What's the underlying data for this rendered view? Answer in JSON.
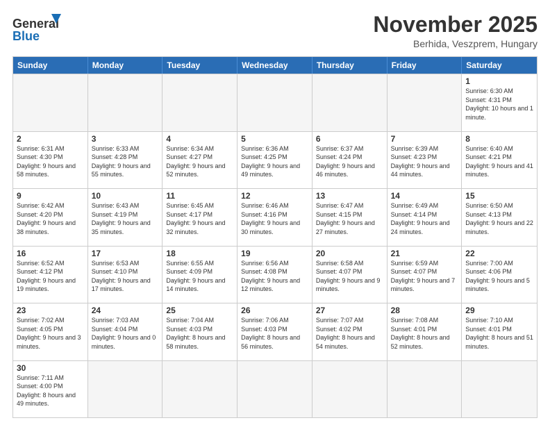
{
  "logo": {
    "text_general": "General",
    "text_blue": "Blue"
  },
  "title": "November 2025",
  "subtitle": "Berhida, Veszprem, Hungary",
  "header_days": [
    "Sunday",
    "Monday",
    "Tuesday",
    "Wednesday",
    "Thursday",
    "Friday",
    "Saturday"
  ],
  "weeks": [
    [
      {
        "day": "",
        "info": "",
        "empty": true
      },
      {
        "day": "",
        "info": "",
        "empty": true
      },
      {
        "day": "",
        "info": "",
        "empty": true
      },
      {
        "day": "",
        "info": "",
        "empty": true
      },
      {
        "day": "",
        "info": "",
        "empty": true
      },
      {
        "day": "",
        "info": "",
        "empty": true
      },
      {
        "day": "1",
        "info": "Sunrise: 6:30 AM\nSunset: 4:31 PM\nDaylight: 10 hours\nand 1 minute.",
        "empty": false
      }
    ],
    [
      {
        "day": "2",
        "info": "Sunrise: 6:31 AM\nSunset: 4:30 PM\nDaylight: 9 hours\nand 58 minutes.",
        "empty": false
      },
      {
        "day": "3",
        "info": "Sunrise: 6:33 AM\nSunset: 4:28 PM\nDaylight: 9 hours\nand 55 minutes.",
        "empty": false
      },
      {
        "day": "4",
        "info": "Sunrise: 6:34 AM\nSunset: 4:27 PM\nDaylight: 9 hours\nand 52 minutes.",
        "empty": false
      },
      {
        "day": "5",
        "info": "Sunrise: 6:36 AM\nSunset: 4:25 PM\nDaylight: 9 hours\nand 49 minutes.",
        "empty": false
      },
      {
        "day": "6",
        "info": "Sunrise: 6:37 AM\nSunset: 4:24 PM\nDaylight: 9 hours\nand 46 minutes.",
        "empty": false
      },
      {
        "day": "7",
        "info": "Sunrise: 6:39 AM\nSunset: 4:23 PM\nDaylight: 9 hours\nand 44 minutes.",
        "empty": false
      },
      {
        "day": "8",
        "info": "Sunrise: 6:40 AM\nSunset: 4:21 PM\nDaylight: 9 hours\nand 41 minutes.",
        "empty": false
      }
    ],
    [
      {
        "day": "9",
        "info": "Sunrise: 6:42 AM\nSunset: 4:20 PM\nDaylight: 9 hours\nand 38 minutes.",
        "empty": false
      },
      {
        "day": "10",
        "info": "Sunrise: 6:43 AM\nSunset: 4:19 PM\nDaylight: 9 hours\nand 35 minutes.",
        "empty": false
      },
      {
        "day": "11",
        "info": "Sunrise: 6:45 AM\nSunset: 4:17 PM\nDaylight: 9 hours\nand 32 minutes.",
        "empty": false
      },
      {
        "day": "12",
        "info": "Sunrise: 6:46 AM\nSunset: 4:16 PM\nDaylight: 9 hours\nand 30 minutes.",
        "empty": false
      },
      {
        "day": "13",
        "info": "Sunrise: 6:47 AM\nSunset: 4:15 PM\nDaylight: 9 hours\nand 27 minutes.",
        "empty": false
      },
      {
        "day": "14",
        "info": "Sunrise: 6:49 AM\nSunset: 4:14 PM\nDaylight: 9 hours\nand 24 minutes.",
        "empty": false
      },
      {
        "day": "15",
        "info": "Sunrise: 6:50 AM\nSunset: 4:13 PM\nDaylight: 9 hours\nand 22 minutes.",
        "empty": false
      }
    ],
    [
      {
        "day": "16",
        "info": "Sunrise: 6:52 AM\nSunset: 4:12 PM\nDaylight: 9 hours\nand 19 minutes.",
        "empty": false
      },
      {
        "day": "17",
        "info": "Sunrise: 6:53 AM\nSunset: 4:10 PM\nDaylight: 9 hours\nand 17 minutes.",
        "empty": false
      },
      {
        "day": "18",
        "info": "Sunrise: 6:55 AM\nSunset: 4:09 PM\nDaylight: 9 hours\nand 14 minutes.",
        "empty": false
      },
      {
        "day": "19",
        "info": "Sunrise: 6:56 AM\nSunset: 4:08 PM\nDaylight: 9 hours\nand 12 minutes.",
        "empty": false
      },
      {
        "day": "20",
        "info": "Sunrise: 6:58 AM\nSunset: 4:07 PM\nDaylight: 9 hours\nand 9 minutes.",
        "empty": false
      },
      {
        "day": "21",
        "info": "Sunrise: 6:59 AM\nSunset: 4:07 PM\nDaylight: 9 hours\nand 7 minutes.",
        "empty": false
      },
      {
        "day": "22",
        "info": "Sunrise: 7:00 AM\nSunset: 4:06 PM\nDaylight: 9 hours\nand 5 minutes.",
        "empty": false
      }
    ],
    [
      {
        "day": "23",
        "info": "Sunrise: 7:02 AM\nSunset: 4:05 PM\nDaylight: 9 hours\nand 3 minutes.",
        "empty": false
      },
      {
        "day": "24",
        "info": "Sunrise: 7:03 AM\nSunset: 4:04 PM\nDaylight: 9 hours\nand 0 minutes.",
        "empty": false
      },
      {
        "day": "25",
        "info": "Sunrise: 7:04 AM\nSunset: 4:03 PM\nDaylight: 8 hours\nand 58 minutes.",
        "empty": false
      },
      {
        "day": "26",
        "info": "Sunrise: 7:06 AM\nSunset: 4:03 PM\nDaylight: 8 hours\nand 56 minutes.",
        "empty": false
      },
      {
        "day": "27",
        "info": "Sunrise: 7:07 AM\nSunset: 4:02 PM\nDaylight: 8 hours\nand 54 minutes.",
        "empty": false
      },
      {
        "day": "28",
        "info": "Sunrise: 7:08 AM\nSunset: 4:01 PM\nDaylight: 8 hours\nand 52 minutes.",
        "empty": false
      },
      {
        "day": "29",
        "info": "Sunrise: 7:10 AM\nSunset: 4:01 PM\nDaylight: 8 hours\nand 51 minutes.",
        "empty": false
      }
    ],
    [
      {
        "day": "30",
        "info": "Sunrise: 7:11 AM\nSunset: 4:00 PM\nDaylight: 8 hours\nand 49 minutes.",
        "empty": false
      },
      {
        "day": "",
        "info": "",
        "empty": true
      },
      {
        "day": "",
        "info": "",
        "empty": true
      },
      {
        "day": "",
        "info": "",
        "empty": true
      },
      {
        "day": "",
        "info": "",
        "empty": true
      },
      {
        "day": "",
        "info": "",
        "empty": true
      },
      {
        "day": "",
        "info": "",
        "empty": true
      }
    ]
  ]
}
